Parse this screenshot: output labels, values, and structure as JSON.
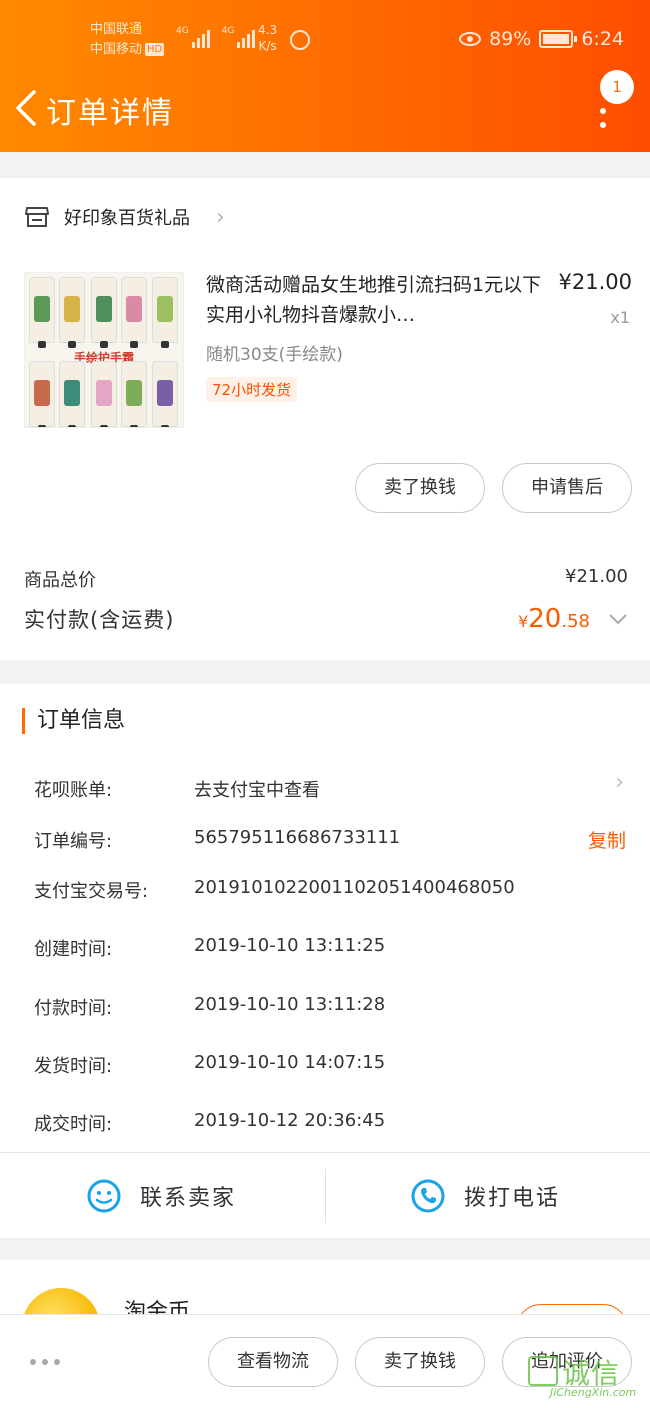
{
  "status_bar": {
    "carrier1": "中国联通",
    "carrier2": "中国移动",
    "carrier2_badge": "HD",
    "signal1_label": "4G",
    "signal2_label": "4G",
    "net_speed_value": "4.3",
    "net_speed_unit": "K/s",
    "battery": "89%",
    "time": "6:24"
  },
  "header": {
    "title": "订单详情",
    "badge_count": "1"
  },
  "shop": {
    "name": "好印象百货礼品"
  },
  "product": {
    "title": "微商活动赠品女生地推引流扫码1元以下实用小礼物抖音爆款小…",
    "price": "¥21.00",
    "quantity": "x1",
    "spec": "随机30支(手绘款)",
    "tag": "72小时发货",
    "image_caption": "手绘护手霜"
  },
  "item_actions": {
    "sell_label": "卖了换钱",
    "after_sale_label": "申请售后"
  },
  "summary": {
    "total_label": "商品总价",
    "total_value": "¥21.00",
    "paid_label": "实付款(含运费)",
    "paid_currency": "¥",
    "paid_integer": "20",
    "paid_decimal": ".58"
  },
  "order_info": {
    "section_title": "订单信息",
    "copy_label": "复制",
    "rows": [
      {
        "label": "花呗账单:",
        "value": "去支付宝中查看"
      },
      {
        "label": "订单编号:",
        "value": "565795116686733111"
      },
      {
        "label": "支付宝交易号:",
        "value": "2019101022001102051400468050"
      },
      {
        "label": "创建时间:",
        "value": "2019-10-10 13:11:25"
      },
      {
        "label": "付款时间:",
        "value": "2019-10-10 13:11:28"
      },
      {
        "label": "发货时间:",
        "value": "2019-10-10 14:07:15"
      },
      {
        "label": "成交时间:",
        "value": "2019-10-12 20:36:45"
      }
    ]
  },
  "contact": {
    "seller_label": "联系卖家",
    "call_label": "拨打电话"
  },
  "coin": {
    "title": "淘金币"
  },
  "bottom_bar": {
    "logistics_label": "查看物流",
    "sell_label": "卖了换钱",
    "review_label": "追加评价"
  },
  "watermark": {
    "text": "诚信",
    "url": "JiChengXin.com"
  },
  "colors": {
    "header_start": "#ff8a00",
    "header_end": "#ff4d00",
    "accent": "#ff5a00"
  }
}
